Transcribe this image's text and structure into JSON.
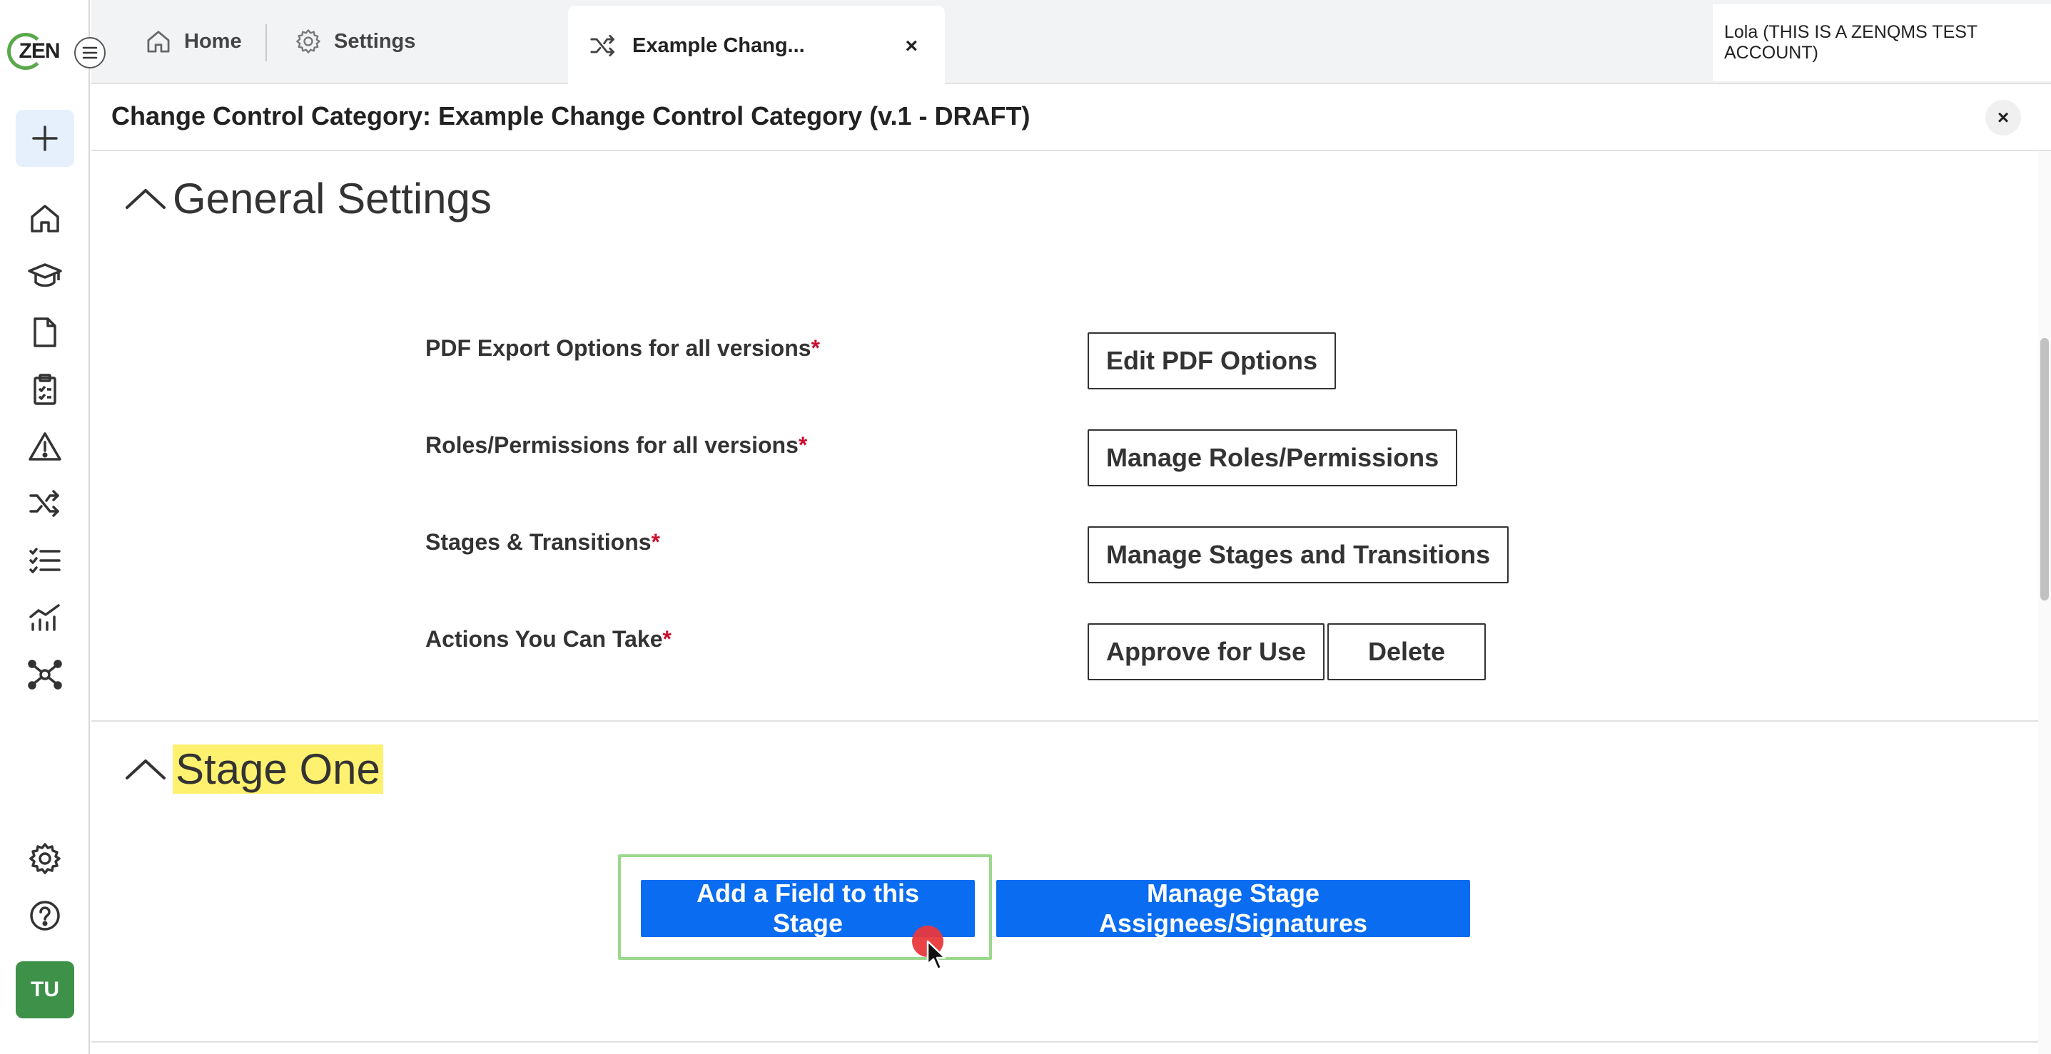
{
  "sidebar": {
    "logo_text": "ZEN",
    "items": [
      {
        "icon": "home-icon"
      },
      {
        "icon": "graduation-cap-icon"
      },
      {
        "icon": "document-icon"
      },
      {
        "icon": "clipboard-checklist-icon"
      },
      {
        "icon": "warning-triangle-icon"
      },
      {
        "icon": "shuffle-icon"
      },
      {
        "icon": "checklist-icon"
      },
      {
        "icon": "analytics-chart-icon"
      },
      {
        "icon": "network-icon"
      }
    ],
    "bottom_items": [
      {
        "icon": "gear-icon"
      },
      {
        "icon": "help-icon"
      }
    ],
    "avatar_initials": "TU"
  },
  "tabs": [
    {
      "label": "Home",
      "icon": "home-icon"
    },
    {
      "label": "Settings",
      "icon": "gear-icon"
    },
    {
      "label": "Example Chang...",
      "icon": "shuffle-icon",
      "active": true,
      "close": "×"
    }
  ],
  "user": {
    "label": "Lola (THIS IS A ZENQMS TEST ACCOUNT)"
  },
  "header": {
    "title": "Change Control Category: Example Change Control Category (v.1 - DRAFT)",
    "close": "×"
  },
  "general_settings": {
    "title": "General Settings",
    "rows": [
      {
        "label": "PDF Export Options for all versions",
        "required": "*",
        "buttons": [
          "Edit PDF Options"
        ]
      },
      {
        "label": "Roles/Permissions for all versions",
        "required": "*",
        "buttons": [
          "Manage Roles/Permissions"
        ]
      },
      {
        "label": "Stages & Transitions",
        "required": "*",
        "buttons": [
          "Manage Stages and Transitions"
        ]
      },
      {
        "label": "Actions You Can Take",
        "required": "*",
        "buttons": [
          "Approve for Use",
          "Delete"
        ]
      }
    ]
  },
  "stage_one": {
    "title": "Stage One",
    "add_field_label": "Add a Field to this Stage",
    "manage_assignees_label": "Manage Stage Assignees/Signatures"
  },
  "colors": {
    "primary": "#0a6cf0",
    "highlight": "#fff170",
    "avatar": "#3d9148",
    "required": "#c8102e",
    "focus_ring": "#9bd88d"
  }
}
